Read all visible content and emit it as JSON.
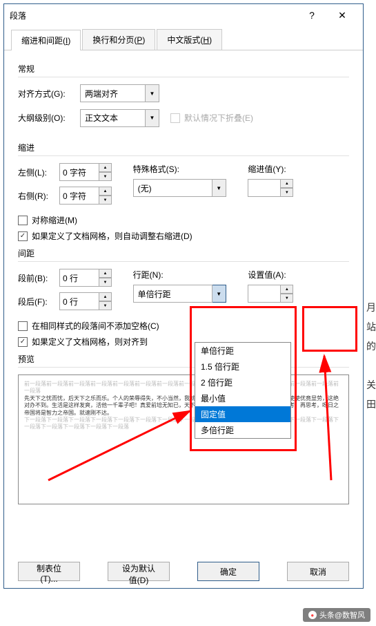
{
  "title": "段落",
  "tabs": [
    {
      "label": "缩进和间距",
      "key": "I",
      "active": true
    },
    {
      "label": "换行和分页",
      "key": "P",
      "active": false
    },
    {
      "label": "中文版式",
      "key": "H",
      "active": false
    }
  ],
  "groups": {
    "general": {
      "title": "常规"
    },
    "indent": {
      "title": "缩进"
    },
    "spacing": {
      "title": "间距"
    },
    "preview": {
      "title": "预览"
    }
  },
  "fields": {
    "align": {
      "label": "对齐方式(G):",
      "key": "G",
      "value": "两端对齐"
    },
    "outline": {
      "label": "大纲级别(O):",
      "key": "O",
      "value": "正文文本"
    },
    "collapse": {
      "label": "默认情况下折叠(E)",
      "key": "E",
      "checked": false
    },
    "left": {
      "label": "左侧(L):",
      "key": "L",
      "value": "0 字符"
    },
    "right": {
      "label": "右侧(R):",
      "key": "R",
      "value": "0 字符"
    },
    "special": {
      "label": "特殊格式(S):",
      "key": "S",
      "value": "(无)"
    },
    "indentval": {
      "label": "缩进值(Y):",
      "key": "Y",
      "value": ""
    },
    "mirror": {
      "label": "对称缩进(M)",
      "key": "M",
      "checked": false
    },
    "autoindent": {
      "label": "如果定义了文档网格，则自动调整右缩进(D)",
      "key": "D",
      "checked": true
    },
    "before": {
      "label": "段前(B):",
      "key": "B",
      "value": "0 行"
    },
    "after": {
      "label": "段后(F):",
      "key": "F",
      "value": "0 行"
    },
    "linespace": {
      "label": "行距(N):",
      "key": "N",
      "value": "单倍行距"
    },
    "setval": {
      "label": "设置值(A):",
      "key": "A",
      "value": ""
    },
    "nosame": {
      "label": "在相同样式的段落间不添加空格(C)",
      "key": "C",
      "checked": false
    },
    "snapgrid": {
      "label": "如果定义了文档网格，则对齐到",
      "key": "W",
      "checked": true
    }
  },
  "dropdown_options": [
    "单倍行距",
    "1.5 倍行距",
    "2 倍行距",
    "最小值",
    "固定值",
    "多倍行距"
  ],
  "dropdown_selected": "固定值",
  "preview_gray": "前一段落前一段落前一段落前一段落前一段落前一段落前一段落前一段落前一段落前一段落前一段落前一段落前一段落前一段落前一段落",
  "preview_text": "先天下之忧而忧，后天下之乐而乐。个人的荣辱得失，不小当然，我就怀一意愿足。赏我住会谈的呀师，它竟使使优竟显劳，这绝对办不到。生活是这样发爽，活他一千辈子吧！真爱前培无知已，天下谁人不识君。学习知识要善于思考。思考，再思考，呀日之帝国将是智力之帝国。就速刚不达。",
  "preview_gray2": "下一段落下一段落下一段落下一段落下一段落下一段落下一段落下一段落下一段落下一段落下一段落下一段落下一段落下一段落下一段落下一段落下一段落下一段落下一段落",
  "buttons": {
    "tabstops": "制表位(T)...",
    "default": "设为默认值(D)",
    "ok": "确定",
    "cancel": "取消"
  },
  "watermark": "头条@数智风",
  "sidechars": [
    "月",
    "站",
    "的",
    "关",
    "田"
  ]
}
